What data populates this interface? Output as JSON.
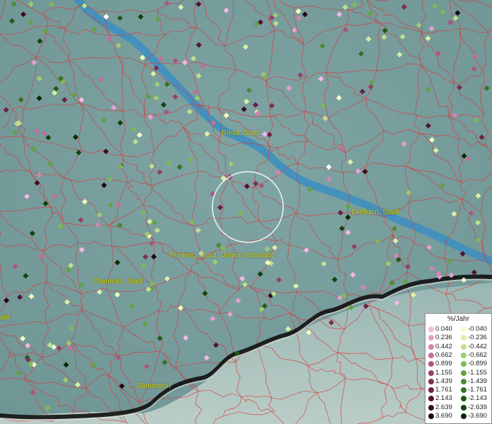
{
  "map": {
    "places": [
      {
        "name": "Riesa, Stadt"
      },
      {
        "name": "Dresden, Stadt"
      },
      {
        "name": "Freiberg, Stadt, Universitätsstadt"
      },
      {
        "name": "Chemnitz, Stadt"
      },
      {
        "name": "Bärenstein"
      },
      {
        "name": "adt"
      }
    ]
  },
  "legend": {
    "title": "%/Jahr",
    "positive": [
      {
        "label": "0.040",
        "color": "#f4b8e4"
      },
      {
        "label": "0.236",
        "color": "#e6a0cd"
      },
      {
        "label": "0.442",
        "color": "#d684b2"
      },
      {
        "label": "0.662",
        "color": "#c46e9c"
      },
      {
        "label": "0.899",
        "color": "#aa5680"
      },
      {
        "label": "1.155",
        "color": "#93416a"
      },
      {
        "label": "1.439",
        "color": "#7e2e55"
      },
      {
        "label": "1.761",
        "color": "#6a2043"
      },
      {
        "label": "2.143",
        "color": "#531430"
      },
      {
        "label": "2.639",
        "color": "#3b0b20"
      },
      {
        "label": "3.690",
        "color": "#220512"
      }
    ],
    "negative": [
      {
        "label": "-0.040",
        "color": "#f3ffc4"
      },
      {
        "label": "-0.236",
        "color": "#d9f0a6"
      },
      {
        "label": "-0.442",
        "color": "#bde18c"
      },
      {
        "label": "-0.662",
        "color": "#9ccd6f"
      },
      {
        "label": "-0.899",
        "color": "#7fb957"
      },
      {
        "label": "-1.155",
        "color": "#63a244"
      },
      {
        "label": "-1.439",
        "color": "#4b8a33"
      },
      {
        "label": "-1.761",
        "color": "#357225"
      },
      {
        "label": "-2.143",
        "color": "#225a18"
      },
      {
        "label": "-2.639",
        "color": "#12430e"
      },
      {
        "label": "-3.690",
        "color": "#062a05"
      }
    ]
  }
}
